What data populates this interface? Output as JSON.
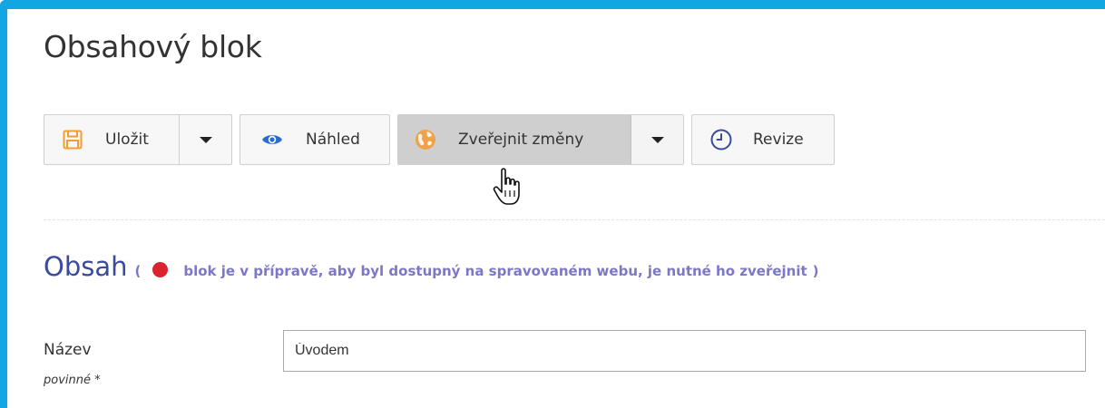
{
  "page": {
    "title": "Obsahový blok"
  },
  "toolbar": {
    "save": {
      "label": "Uložit",
      "icon": "floppy-disk-icon",
      "icon_color": "#f39c34"
    },
    "preview": {
      "label": "Náhled",
      "icon": "eye-icon",
      "icon_color": "#2a6ad1"
    },
    "publish": {
      "label": "Zveřejnit změny",
      "icon": "globe-icon",
      "icon_color": "#f0a24a",
      "state": "hover"
    },
    "revisions": {
      "label": "Revize",
      "icon": "clock-icon",
      "icon_color": "#3a4a9c"
    }
  },
  "content_section": {
    "title": "Obsah",
    "paren_open": "(",
    "paren_close": ")",
    "status_color": "#d9242d",
    "status_text": "blok je v přípravě, aby byl dostupný na spravovaném webu, je nutné ho zveřejnit"
  },
  "form": {
    "name_field": {
      "label": "Název",
      "required": "povinné *",
      "value": "Úvodem"
    }
  },
  "colors": {
    "frame": "#12a6e2",
    "accent": "#3a4a9c",
    "status_text": "#7c77c7"
  }
}
